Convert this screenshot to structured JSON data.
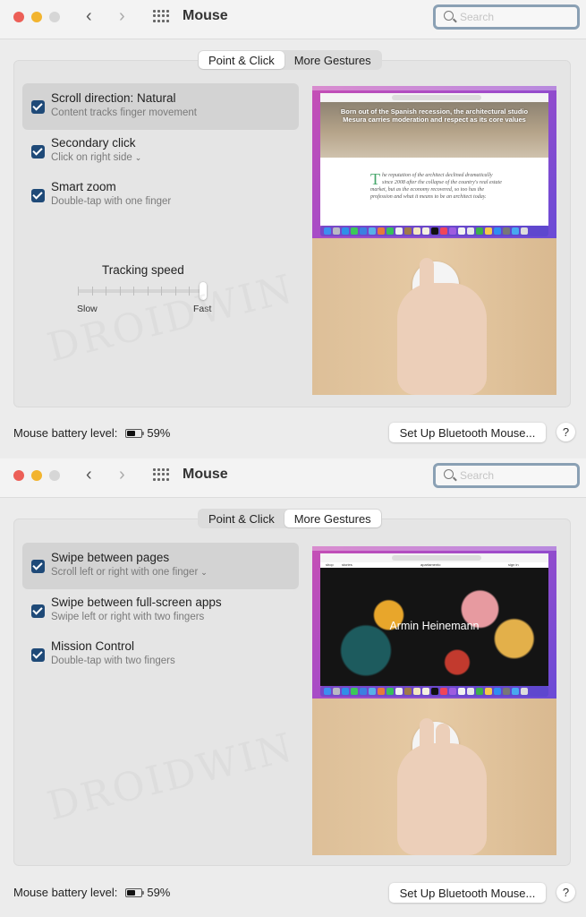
{
  "windows": [
    {
      "title": "Mouse",
      "search": {
        "placeholder": "Search",
        "value": ""
      },
      "tabs": [
        {
          "label": "Point & Click",
          "active": true
        },
        {
          "label": "More Gestures",
          "active": false
        }
      ],
      "options": [
        {
          "title": "Scroll direction: Natural",
          "subtitle": "Content tracks finger movement",
          "checked": true,
          "selected": true,
          "has_dropdown": false
        },
        {
          "title": "Secondary click",
          "subtitle": "Click on right side",
          "checked": true,
          "selected": false,
          "has_dropdown": true
        },
        {
          "title": "Smart zoom",
          "subtitle": "Double-tap with one finger",
          "checked": true,
          "selected": false,
          "has_dropdown": false
        }
      ],
      "tracking": {
        "label": "Tracking speed",
        "min_label": "Slow",
        "max_label": "Fast",
        "value_fraction": 1.0,
        "ticks": 10
      },
      "preview": {
        "headline": "Born out of the Spanish recession, the architectural studio Mesura carries moderation and respect as its core values",
        "article_text": "he reputation of the architect declined dramatically since 2008 after the collapse of the country's real estate market, but as the economy recovered, so too has the profession and what it means to be an architect today.",
        "dropcap": "T"
      },
      "battery": {
        "label": "Mouse battery level:",
        "percent_text": "59%",
        "level": 0.59
      },
      "setup_button": "Set Up Bluetooth Mouse...",
      "help_button": "?"
    },
    {
      "title": "Mouse",
      "search": {
        "placeholder": "Search",
        "value": ""
      },
      "tabs": [
        {
          "label": "Point & Click",
          "active": false
        },
        {
          "label": "More Gestures",
          "active": true
        }
      ],
      "options": [
        {
          "title": "Swipe between pages",
          "subtitle": "Scroll left or right with one finger",
          "checked": true,
          "selected": true,
          "has_dropdown": true
        },
        {
          "title": "Swipe between full-screen apps",
          "subtitle": "Swipe left or right with two fingers",
          "checked": true,
          "selected": false,
          "has_dropdown": false
        },
        {
          "title": "Mission Control",
          "subtitle": "Double-tap with two fingers",
          "checked": true,
          "selected": false,
          "has_dropdown": false
        }
      ],
      "preview": {
        "site_name": "apartamento",
        "nav_left": [
          "shop",
          "stories"
        ],
        "nav_right": "sign in",
        "headline": "Armin Heinemann"
      },
      "battery": {
        "label": "Mouse battery level:",
        "percent_text": "59%",
        "level": 0.59
      },
      "setup_button": "Set Up Bluetooth Mouse...",
      "help_button": "?"
    }
  ],
  "watermark": "DROIDWIN",
  "colors": {
    "checkbox": "#1f4a78",
    "close": "#ec5f57",
    "minimize": "#f2b42f",
    "maximize": "#d6d6d6",
    "search_border": "#8aa0b4"
  }
}
